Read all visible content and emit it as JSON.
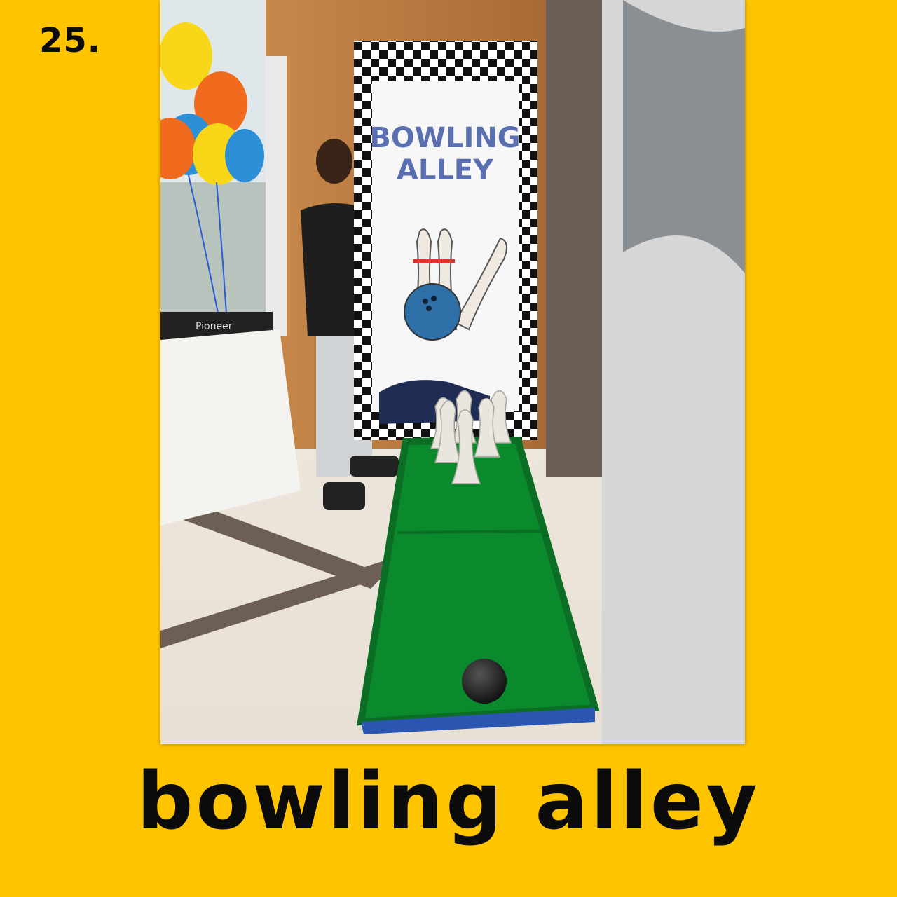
{
  "page": {
    "background_color": "#FFC400",
    "item_number": "25.",
    "caption": "bowling alley"
  },
  "photo": {
    "sign_line1": "BOWLING",
    "sign_line2": "ALLEY",
    "dj_brand": "Pioneer"
  }
}
